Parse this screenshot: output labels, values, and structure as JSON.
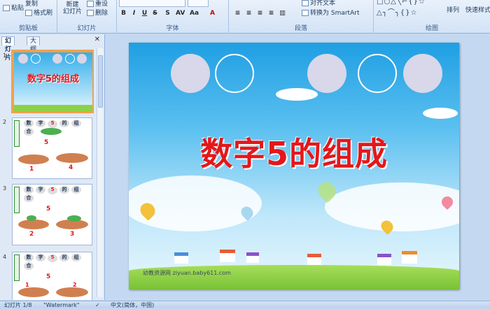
{
  "ribbon": {
    "clipboard": {
      "label": "剪贴板",
      "paste": "粘贴",
      "copy": "复制",
      "format_painter": "格式刷"
    },
    "slides": {
      "label": "幻灯片",
      "new_slide": "新建",
      "new_slide_2": "幻灯片",
      "reset": "重设",
      "delete": "删除"
    },
    "font": {
      "label": "字体"
    },
    "paragraph": {
      "label": "段落",
      "align_text": "对齐文本",
      "convert_smartart": "转换为 SmartArt"
    },
    "drawing": {
      "label": "绘图",
      "arrange": "排列",
      "quick_styles": "快速样式"
    }
  },
  "panel": {
    "tab_slides": "幻灯片",
    "tab_outline": "大纲",
    "thumbs": [
      {
        "num": "1",
        "title": "数字5的组成"
      },
      {
        "num": "2",
        "header": [
          "数",
          "字",
          "5",
          "的",
          "组",
          "合"
        ],
        "left": "1",
        "right": "4"
      },
      {
        "num": "3",
        "header": [
          "数",
          "字",
          "5",
          "的",
          "组",
          "合"
        ],
        "left": "2",
        "right": "3"
      },
      {
        "num": "4",
        "header": [
          "数",
          "字",
          "5",
          "的",
          "组",
          "合"
        ],
        "left": "1",
        "right": "2"
      }
    ],
    "center_num": "5"
  },
  "slide": {
    "title": "数字5的组成",
    "watermark": "幼教资源网 ziyuan.baby611.com"
  },
  "status": {
    "slide_count": "幻灯片 1/8",
    "theme": "\"Watermark\"",
    "language": "中文(简体，中国)"
  },
  "colors": {
    "title_red": "#e4171b",
    "selection_orange": "#f5a04a",
    "ribbon_blue": "#d3e3f6",
    "sky_blue": "#1f9fe3",
    "grass_green": "#8bd246"
  }
}
